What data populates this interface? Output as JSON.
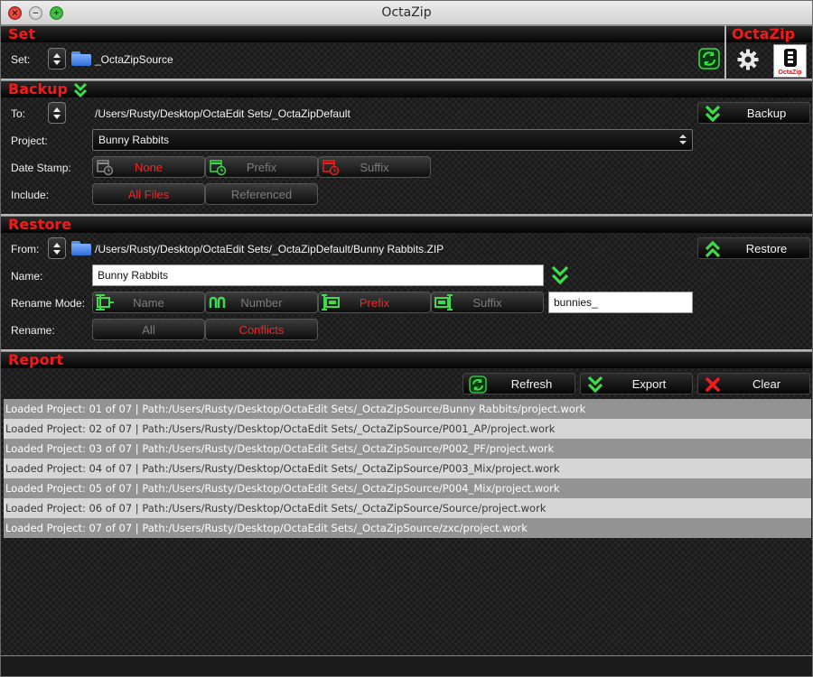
{
  "window": {
    "title": "OctaZip"
  },
  "set": {
    "section_title": "Set",
    "label": "Set:",
    "value": "_OctaZipSource",
    "brand_title": "OctaZip",
    "logo_text": "OctaZip"
  },
  "backup": {
    "section_title": "Backup",
    "to_label": "To:",
    "to_path": "/Users/Rusty/Desktop/OctaEdit Sets/_OctaZipDefault",
    "action_label": "Backup",
    "project_label": "Project:",
    "project_value": "Bunny Rabbits",
    "datestamp_label": "Date Stamp:",
    "datestamp_options": [
      {
        "label": "None",
        "selected": true
      },
      {
        "label": "Prefix",
        "selected": false
      },
      {
        "label": "Suffix",
        "selected": false
      }
    ],
    "include_label": "Include:",
    "include_options": [
      {
        "label": "All Files",
        "selected": true
      },
      {
        "label": "Referenced",
        "selected": false
      }
    ]
  },
  "restore": {
    "section_title": "Restore",
    "from_label": "From:",
    "from_path": "/Users/Rusty/Desktop/OctaEdit Sets/_OctaZipDefault/Bunny Rabbits.ZIP",
    "action_label": "Restore",
    "name_label": "Name:",
    "name_value": "Bunny Rabbits",
    "rename_mode_label": "Rename Mode:",
    "rename_mode_options": [
      {
        "label": "Name",
        "selected": false
      },
      {
        "label": "Number",
        "selected": false
      },
      {
        "label": "Prefix",
        "selected": true
      },
      {
        "label": "Suffix",
        "selected": false
      }
    ],
    "rename_text": "bunnies_",
    "rename_label": "Rename:",
    "rename_options": [
      {
        "label": "All",
        "selected": false
      },
      {
        "label": "Conflicts",
        "selected": true
      }
    ]
  },
  "report": {
    "section_title": "Report",
    "refresh_label": "Refresh",
    "export_label": "Export",
    "clear_label": "Clear",
    "lines": [
      "Loaded Project: 01 of 07 | Path:/Users/Rusty/Desktop/OctaEdit Sets/_OctaZipSource/Bunny Rabbits/project.work",
      "Loaded Project: 02 of 07 | Path:/Users/Rusty/Desktop/OctaEdit Sets/_OctaZipSource/P001_AP/project.work",
      "Loaded Project: 03 of 07 | Path:/Users/Rusty/Desktop/OctaEdit Sets/_OctaZipSource/P002_PF/project.work",
      "Loaded Project: 04 of 07 | Path:/Users/Rusty/Desktop/OctaEdit Sets/_OctaZipSource/P003_Mix/project.work",
      "Loaded Project: 05 of 07 | Path:/Users/Rusty/Desktop/OctaEdit Sets/_OctaZipSource/P004_Mix/project.work",
      "Loaded Project: 06 of 07 | Path:/Users/Rusty/Desktop/OctaEdit Sets/_OctaZipSource/Source/project.work",
      "Loaded Project: 07 of 07 | Path:/Users/Rusty/Desktop/OctaEdit Sets/_OctaZipSource/zxc/project.work"
    ]
  },
  "colors": {
    "accent_red": "#f01c1c",
    "accent_green": "#3ddc4a"
  }
}
